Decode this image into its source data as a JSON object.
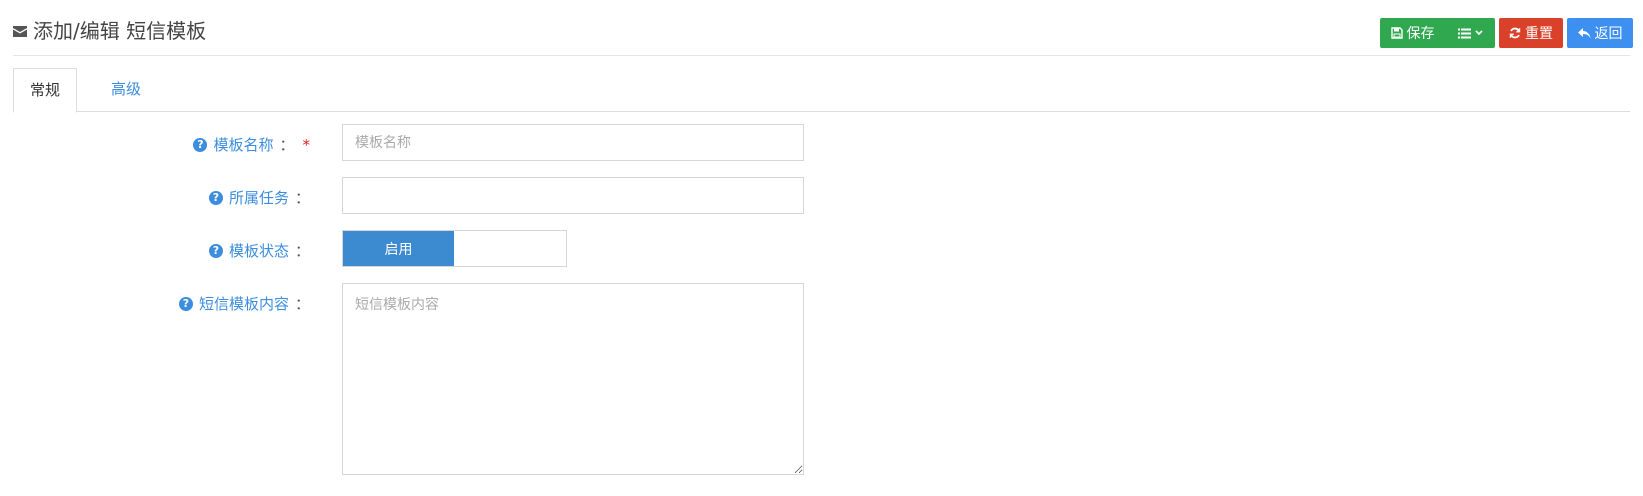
{
  "header": {
    "icon": "envelope-icon",
    "title": "添加/编辑 短信模板"
  },
  "toolbar": {
    "save_label": "保存",
    "reset_label": "重置",
    "back_label": "返回",
    "colors": {
      "save": "#2fa84f",
      "reset": "#d9412b",
      "back": "#3d8ff0"
    }
  },
  "tabs": [
    {
      "label": "常规",
      "active": true
    },
    {
      "label": "高级",
      "active": false
    }
  ],
  "form": {
    "name": {
      "label": "模板名称",
      "colon": "：",
      "required_mark": "*",
      "placeholder": "模板名称",
      "value": ""
    },
    "task": {
      "label": "所属任务",
      "colon": "：",
      "value": ""
    },
    "status": {
      "label": "模板状态",
      "colon": "：",
      "on_label": "启用",
      "value": "启用"
    },
    "content": {
      "label": "短信模板内容",
      "colon": "：",
      "placeholder": "短信模板内容",
      "value": ""
    }
  },
  "colors": {
    "accent": "#3c8dde",
    "switch_on": "#3c8ad0",
    "required": "#e02020"
  }
}
